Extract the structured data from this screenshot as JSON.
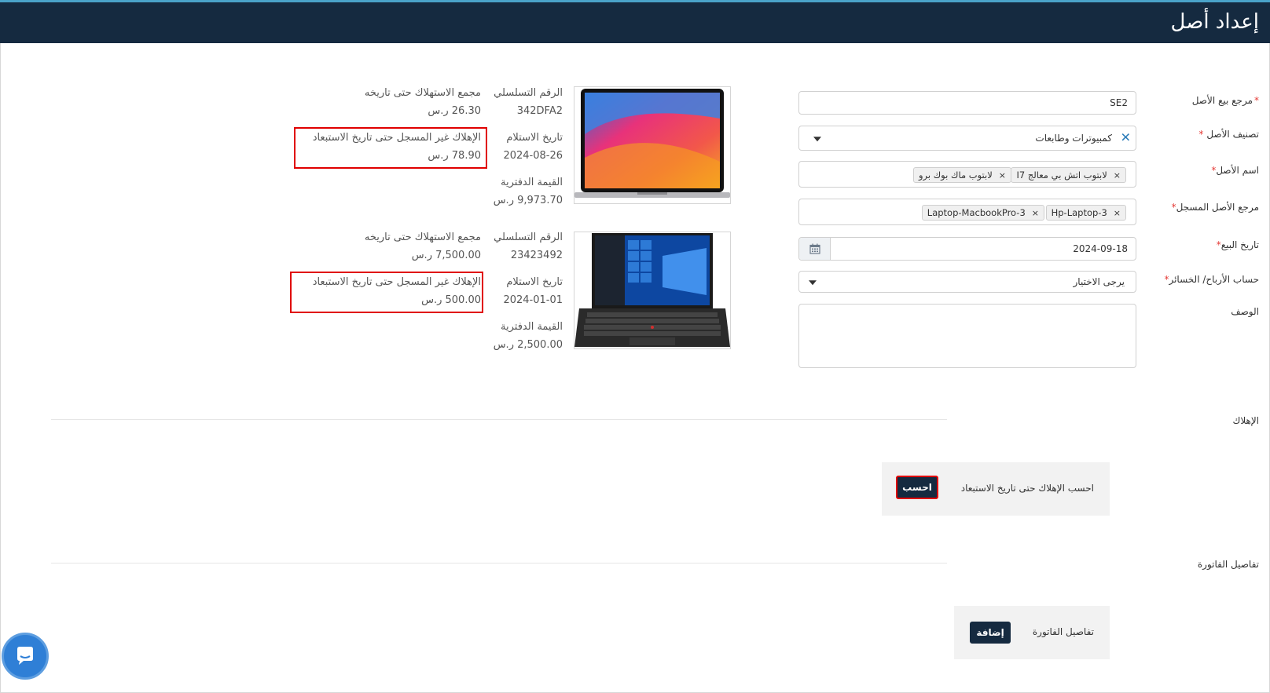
{
  "header": {
    "title": "إعداد أصل"
  },
  "form": {
    "sale_ref": {
      "label": "مرجع بيع الأصل",
      "value": "SE2"
    },
    "category": {
      "label": "تصنيف الأصل",
      "value": "كمبيوترات وطابعات"
    },
    "asset_name": {
      "label": "اسم الأصل",
      "tags": [
        "لابتوب اتش بي معالج I7",
        "لابتوب ماك بوك برو"
      ]
    },
    "registered_ref": {
      "label": "مرجع الأصل المسجل",
      "tags": [
        "Hp-Laptop-3",
        "Laptop-MacbookPro-3"
      ]
    },
    "sale_date": {
      "label": "تاريخ البيع",
      "value": "2024-09-18"
    },
    "pl_account": {
      "label": "حساب الأرباح/ الخسائر",
      "value": "يرجى الاختيار"
    },
    "description": {
      "label": "الوصف",
      "value": ""
    },
    "required_mark": "*"
  },
  "assets": [
    {
      "serial_label": "الرقم التسلسلي",
      "serial": "342DFA2",
      "received_label": "تاريخ الاستلام",
      "received": "2024-08-26",
      "book_label": "القيمة الدفترية",
      "book": "9,973.70 ر.س",
      "accum_label": "مجمع الاستهلاك حتى تاريخه",
      "accum": "26.30 ر.س",
      "unreg_label": "الإهلاك غير المسجل حتى تاريخ الاستبعاد",
      "unreg": "78.90 ر.س",
      "image": "macbook-image"
    },
    {
      "serial_label": "الرقم التسلسلي",
      "serial": "23423492",
      "received_label": "تاريخ الاستلام",
      "received": "2024-01-01",
      "book_label": "القيمة الدفترية",
      "book": "2,500.00 ر.س",
      "accum_label": "مجمع الاستهلاك حتى تاريخه",
      "accum": "7,500.00 ر.س",
      "unreg_label": "الإهلاك غير المسجل حتى تاريخ الاستبعاد",
      "unreg": "500.00 ر.س",
      "image": "thinkpad-image"
    }
  ],
  "depreciation": {
    "section_label": "الإهلاك",
    "panel_text": "احسب الإهلاك حتى تاريخ الاستبعاد",
    "button": "احسب"
  },
  "invoice": {
    "section_label": "تفاصيل الفاتورة",
    "panel_text": "تفاصيل الفاتورة",
    "button": "إضافة"
  },
  "colors": {
    "header": "#152a40",
    "accent_red": "#e00000",
    "link_blue": "#2a7bb8"
  },
  "icons": {
    "calendar": "calendar-icon",
    "chat": "chat-icon",
    "dropdown": "chevron-down-icon"
  }
}
